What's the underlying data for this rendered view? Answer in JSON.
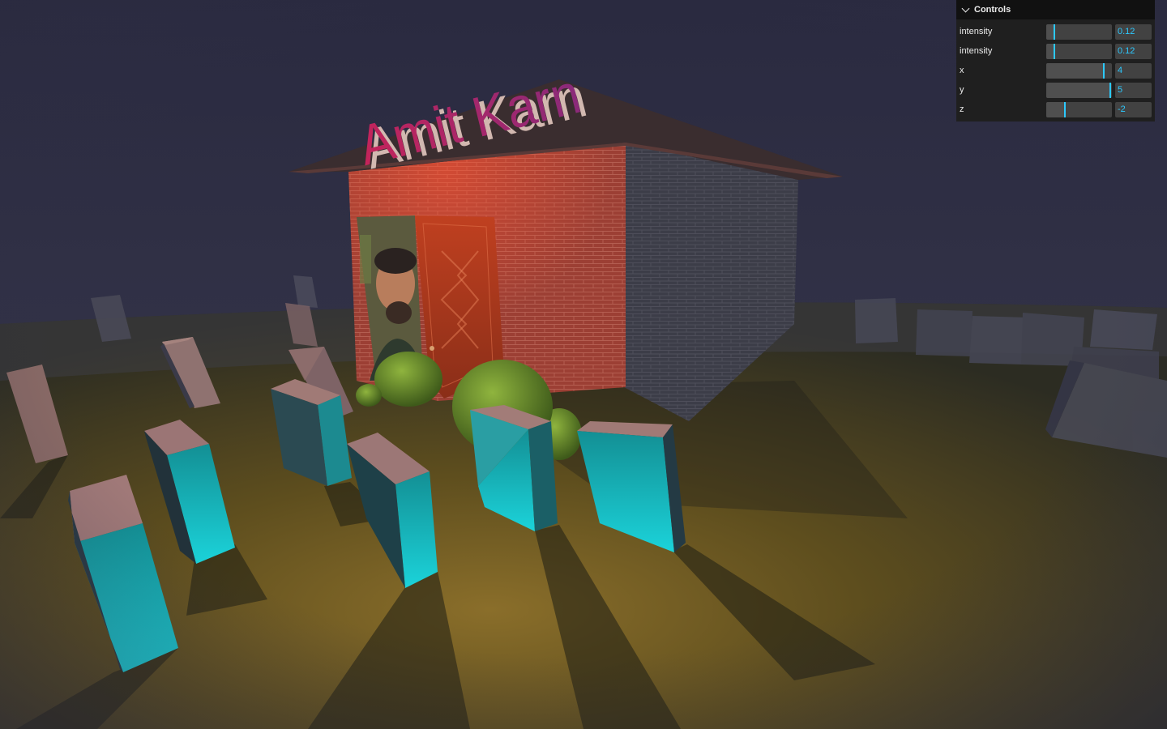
{
  "scene": {
    "sign_text": "Amit Karn",
    "colors": {
      "sky": "#2c2c42",
      "grass": "#6b5a22",
      "brick": "#b5473a",
      "door": "#b53a1c",
      "roof": "#3a2a2a",
      "block_face": "#19a3a8",
      "block_top": "#a87a78",
      "bush": "#6e9a32",
      "sign_front": "#b8275e"
    }
  },
  "controls": {
    "title": "Controls",
    "rows": [
      {
        "label": "intensity",
        "value": "0.12",
        "fraction": 0.12
      },
      {
        "label": "intensity",
        "value": "0.12",
        "fraction": 0.12
      },
      {
        "label": "x",
        "value": "4",
        "fraction": 0.88
      },
      {
        "label": "y",
        "value": "5",
        "fraction": 0.97
      },
      {
        "label": "z",
        "value": "-2",
        "fraction": 0.28
      }
    ]
  }
}
